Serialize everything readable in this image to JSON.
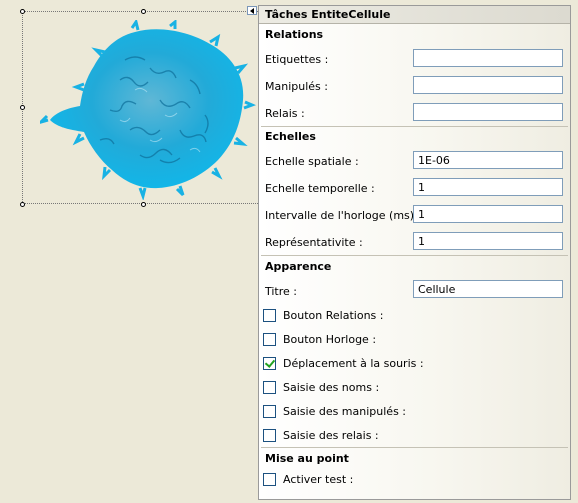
{
  "panel": {
    "title": "Tâches EntiteCellule"
  },
  "sections": {
    "relations": {
      "title": "Relations",
      "etiquettes_label": "Etiquettes :",
      "etiquettes_value": "",
      "manipules_label": "Manipulés :",
      "manipules_value": "",
      "relais_label": "Relais :",
      "relais_value": ""
    },
    "echelles": {
      "title": "Echelles",
      "spatiale_label": "Echelle spatiale :",
      "spatiale_value": "1E-06",
      "temporelle_label": "Echelle temporelle :",
      "temporelle_value": "1",
      "intervalle_label": "Intervalle de l'horloge (ms) :",
      "intervalle_value": "1",
      "representativite_label": "Représentativite :",
      "representativite_value": "1"
    },
    "apparence": {
      "title": "Apparence",
      "titre_label": "Titre :",
      "titre_value": "Cellule",
      "checks": [
        {
          "label": "Bouton Relations :",
          "checked": false
        },
        {
          "label": "Bouton Horloge :",
          "checked": false
        },
        {
          "label": "Déplacement à la souris :",
          "checked": true
        },
        {
          "label": "Saisie des noms :",
          "checked": false
        },
        {
          "label": "Saisie des manipulés :",
          "checked": false
        },
        {
          "label": "Saisie des relais :",
          "checked": false
        }
      ]
    },
    "mise_au_point": {
      "title": "Mise au point",
      "checks": [
        {
          "label": "Activer test :",
          "checked": false
        }
      ]
    }
  },
  "colors": {
    "background": "#ECE9D8",
    "cell": "#1EA8D6",
    "checkmark": "#21A121"
  },
  "icons": {
    "smart_tag": "smart-tag-arrow-icon"
  }
}
